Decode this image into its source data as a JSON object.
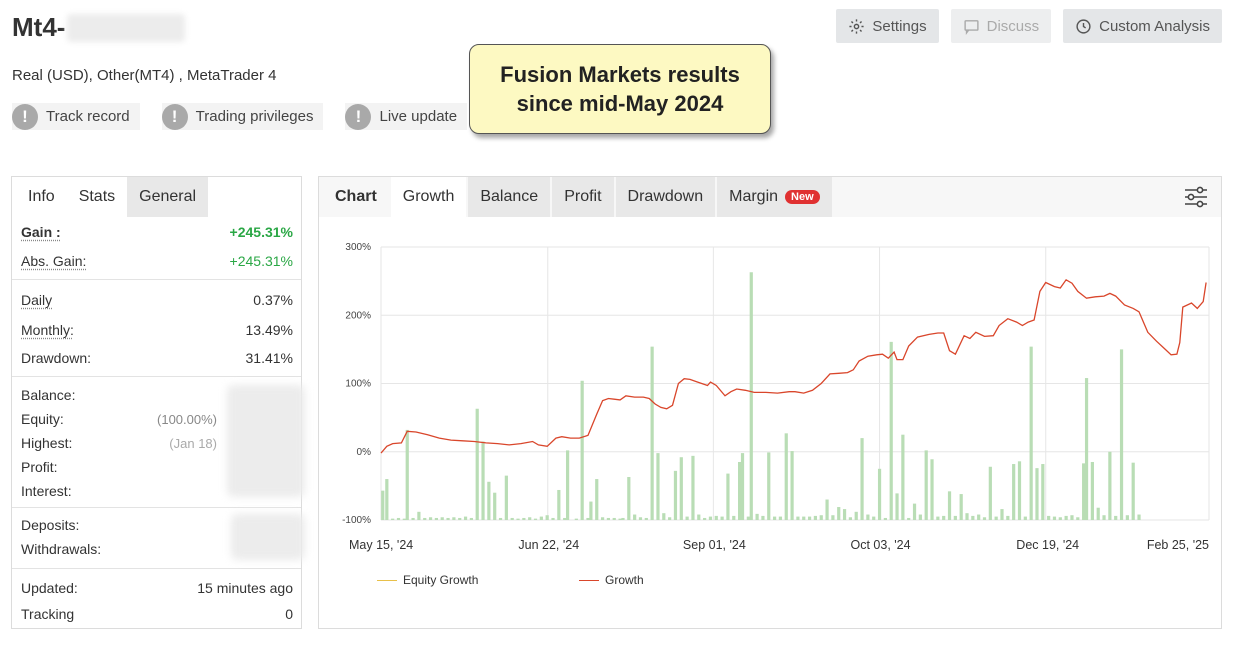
{
  "account": {
    "title_prefix": "Mt4-",
    "subtitle": "Real (USD), Other(MT4) , MetaTrader 4"
  },
  "badges": [
    {
      "label": "Track record",
      "icon": "exclamation-icon"
    },
    {
      "label": "Trading privileges",
      "icon": "exclamation-icon"
    },
    {
      "label": "Live update",
      "icon": "exclamation-icon"
    }
  ],
  "buttons": {
    "settings": "Settings",
    "discuss": "Discuss",
    "custom_analysis": "Custom Analysis"
  },
  "callout": {
    "line1": "Fusion Markets results",
    "line2": "since mid-May 2024"
  },
  "left_tabs": [
    "Info",
    "Stats",
    "General"
  ],
  "stats": {
    "gain_label": "Gain :",
    "gain_value": "+245.31%",
    "abs_gain_label": "Abs. Gain:",
    "abs_gain_value": "+245.31%",
    "daily_label": "Daily",
    "daily_value": "0.37%",
    "monthly_label": "Monthly:",
    "monthly_value": "13.49%",
    "drawdown_label": "Drawdown:",
    "drawdown_value": "31.41%",
    "balance_label": "Balance:",
    "equity_label": "Equity:",
    "equity_pct": "(100.00%)",
    "highest_label": "Highest:",
    "highest_date": "(Jan 18)",
    "profit_label": "Profit:",
    "interest_label": "Interest:",
    "deposits_label": "Deposits:",
    "withdrawals_label": "Withdrawals:",
    "updated_label": "Updated:",
    "updated_value": "15 minutes ago",
    "tracking_label": "Tracking",
    "tracking_value": "0"
  },
  "chart_tabs": {
    "head": "Chart",
    "tabs": [
      "Growth",
      "Balance",
      "Profit",
      "Drawdown",
      "Margin"
    ],
    "active": "Growth",
    "new_badge": "New"
  },
  "colors": {
    "growth_line": "#d9462b",
    "equity_line": "#e8c04a",
    "bars": "#b9ddb5",
    "gain_green": "#2aa745"
  },
  "chart_data": {
    "type": "line",
    "yticks": [
      "300%",
      "200%",
      "100%",
      "0%",
      "-100%"
    ],
    "ylim": [
      -100,
      300
    ],
    "xticks": [
      "May 15, '24",
      "Jun 22, '24",
      "Sep 01, '24",
      "Oct 03, '24",
      "Dec 19, '24",
      "Feb 25, '25"
    ],
    "legend": [
      "Equity Growth",
      "Growth"
    ],
    "growth_series": [
      [
        0,
        -2
      ],
      [
        0.01,
        8
      ],
      [
        0.02,
        12
      ],
      [
        0.035,
        13
      ],
      [
        0.045,
        30
      ],
      [
        0.06,
        29
      ],
      [
        0.08,
        25
      ],
      [
        0.1,
        20
      ],
      [
        0.12,
        17
      ],
      [
        0.14,
        16
      ],
      [
        0.16,
        15
      ],
      [
        0.18,
        13
      ],
      [
        0.2,
        12
      ],
      [
        0.22,
        10
      ],
      [
        0.24,
        12
      ],
      [
        0.26,
        15
      ],
      [
        0.27,
        10
      ],
      [
        0.285,
        8
      ],
      [
        0.3,
        20
      ],
      [
        0.31,
        22
      ],
      [
        0.325,
        20
      ],
      [
        0.34,
        20
      ],
      [
        0.355,
        24
      ],
      [
        0.37,
        55
      ],
      [
        0.38,
        75
      ],
      [
        0.39,
        78
      ],
      [
        0.4,
        77
      ],
      [
        0.41,
        76
      ],
      [
        0.42,
        82
      ],
      [
        0.435,
        80
      ],
      [
        0.45,
        80
      ],
      [
        0.46,
        78
      ],
      [
        0.47,
        70
      ],
      [
        0.48,
        65
      ],
      [
        0.49,
        63
      ],
      [
        0.5,
        68
      ],
      [
        0.51,
        100
      ],
      [
        0.52,
        107
      ],
      [
        0.53,
        106
      ],
      [
        0.54,
        103
      ],
      [
        0.55,
        100
      ],
      [
        0.56,
        97
      ],
      [
        0.565,
        102
      ],
      [
        0.575,
        97
      ],
      [
        0.59,
        82
      ],
      [
        0.6,
        88
      ],
      [
        0.61,
        92
      ],
      [
        0.625,
        90
      ],
      [
        0.64,
        87
      ],
      [
        0.66,
        87
      ],
      [
        0.68,
        86
      ],
      [
        0.7,
        88
      ],
      [
        0.71,
        88
      ],
      [
        0.725,
        86
      ],
      [
        0.74,
        90
      ],
      [
        0.755,
        100
      ],
      [
        0.77,
        114
      ],
      [
        0.785,
        115
      ],
      [
        0.8,
        116
      ],
      [
        0.81,
        120
      ],
      [
        0.82,
        133
      ],
      [
        0.835,
        140
      ],
      [
        0.85,
        142
      ],
      [
        0.86,
        143
      ],
      [
        0.87,
        137
      ],
      [
        0.88,
        146
      ],
      [
        0.885,
        135
      ],
      [
        0.895,
        135
      ],
      [
        0.905,
        155
      ],
      [
        0.92,
        168
      ],
      [
        0.94,
        172
      ],
      [
        0.955,
        174
      ],
      [
        0.965,
        174
      ],
      [
        0.975,
        148
      ],
      [
        0.985,
        143
      ],
      [
        1.0,
        170
      ],
      [
        1.01,
        166
      ],
      [
        1.02,
        175
      ],
      [
        1.035,
        169
      ],
      [
        1.05,
        170
      ],
      [
        1.06,
        185
      ],
      [
        1.075,
        195
      ],
      [
        1.09,
        190
      ],
      [
        1.1,
        185
      ],
      [
        1.11,
        190
      ],
      [
        1.12,
        193
      ],
      [
        1.13,
        235
      ],
      [
        1.14,
        248
      ],
      [
        1.155,
        242
      ],
      [
        1.165,
        240
      ],
      [
        1.175,
        252
      ],
      [
        1.185,
        247
      ],
      [
        1.195,
        235
      ],
      [
        1.21,
        225
      ],
      [
        1.225,
        227
      ],
      [
        1.24,
        228
      ],
      [
        1.25,
        232
      ],
      [
        1.26,
        228
      ],
      [
        1.275,
        215
      ],
      [
        1.29,
        210
      ],
      [
        1.3,
        205
      ],
      [
        1.315,
        175
      ],
      [
        1.33,
        162
      ],
      [
        1.345,
        150
      ],
      [
        1.355,
        142
      ],
      [
        1.365,
        143
      ],
      [
        1.37,
        160
      ],
      [
        1.375,
        212
      ],
      [
        1.39,
        218
      ],
      [
        1.4,
        210
      ],
      [
        1.41,
        220
      ],
      [
        1.415,
        248
      ]
    ],
    "bar_series": [
      [
        0.003,
        -57
      ],
      [
        0.01,
        -40
      ],
      [
        0.02,
        -98
      ],
      [
        0.03,
        -97
      ],
      [
        0.04,
        -98
      ],
      [
        0.045,
        32
      ],
      [
        0.055,
        -97
      ],
      [
        0.065,
        -88
      ],
      [
        0.075,
        -97
      ],
      [
        0.085,
        -96
      ],
      [
        0.095,
        -97
      ],
      [
        0.105,
        -96
      ],
      [
        0.115,
        -97
      ],
      [
        0.125,
        -96
      ],
      [
        0.135,
        -97
      ],
      [
        0.145,
        -95
      ],
      [
        0.155,
        -97
      ],
      [
        0.165,
        63
      ],
      [
        0.175,
        15
      ],
      [
        0.185,
        -44
      ],
      [
        0.195,
        -60
      ],
      [
        0.205,
        -97
      ],
      [
        0.215,
        -35
      ],
      [
        0.225,
        -97
      ],
      [
        0.235,
        -98
      ],
      [
        0.245,
        -97
      ],
      [
        0.255,
        -96
      ],
      [
        0.265,
        -98
      ],
      [
        0.275,
        -95
      ],
      [
        0.285,
        -93
      ],
      [
        0.295,
        -97
      ],
      [
        0.305,
        -56
      ],
      [
        0.315,
        -97
      ],
      [
        0.32,
        2
      ],
      [
        0.335,
        -98
      ],
      [
        0.345,
        104
      ],
      [
        0.355,
        -97
      ],
      [
        0.36,
        -73
      ],
      [
        0.37,
        -40
      ],
      [
        0.38,
        -96
      ],
      [
        0.39,
        -97
      ],
      [
        0.4,
        -97
      ],
      [
        0.41,
        -98
      ],
      [
        0.415,
        -97
      ],
      [
        0.425,
        -37
      ],
      [
        0.435,
        -92
      ],
      [
        0.445,
        -96
      ],
      [
        0.455,
        -97
      ],
      [
        0.465,
        154
      ],
      [
        0.475,
        -2
      ],
      [
        0.485,
        -90
      ],
      [
        0.495,
        -96
      ],
      [
        0.505,
        -28
      ],
      [
        0.515,
        -8
      ],
      [
        0.525,
        -95
      ],
      [
        0.535,
        -6
      ],
      [
        0.545,
        -92
      ],
      [
        0.555,
        -97
      ],
      [
        0.565,
        -95
      ],
      [
        0.575,
        -94
      ],
      [
        0.585,
        -95
      ],
      [
        0.595,
        -32
      ],
      [
        0.605,
        -94
      ],
      [
        0.615,
        -15
      ],
      [
        0.62,
        -2
      ],
      [
        0.63,
        -95
      ],
      [
        0.635,
        263
      ],
      [
        0.645,
        -91
      ],
      [
        0.655,
        -94
      ],
      [
        0.665,
        -1
      ],
      [
        0.675,
        -95
      ],
      [
        0.685,
        -95
      ],
      [
        0.695,
        27
      ],
      [
        0.705,
        1
      ],
      [
        0.715,
        -95
      ],
      [
        0.725,
        -95
      ],
      [
        0.735,
        -95
      ],
      [
        0.745,
        -94
      ],
      [
        0.755,
        -93
      ],
      [
        0.765,
        -70
      ],
      [
        0.775,
        -93
      ],
      [
        0.785,
        -81
      ],
      [
        0.795,
        -84
      ],
      [
        0.805,
        -96
      ],
      [
        0.815,
        -88
      ],
      [
        0.825,
        20
      ],
      [
        0.835,
        -92
      ],
      [
        0.845,
        -95
      ],
      [
        0.855,
        -25
      ],
      [
        0.865,
        -97
      ],
      [
        0.875,
        161
      ],
      [
        0.885,
        -61
      ],
      [
        0.895,
        25
      ],
      [
        0.905,
        -97
      ],
      [
        0.915,
        -76
      ],
      [
        0.925,
        -92
      ],
      [
        0.935,
        2
      ],
      [
        0.945,
        -11
      ],
      [
        0.955,
        -95
      ],
      [
        0.965,
        -94
      ],
      [
        0.975,
        -58
      ],
      [
        0.985,
        -94
      ],
      [
        0.995,
        -62
      ],
      [
        1.005,
        -90
      ],
      [
        1.015,
        -94
      ],
      [
        1.025,
        -92
      ],
      [
        1.035,
        -96
      ],
      [
        1.045,
        -22
      ],
      [
        1.055,
        -95
      ],
      [
        1.065,
        -84
      ],
      [
        1.075,
        -94
      ],
      [
        1.085,
        -18
      ],
      [
        1.095,
        -14
      ],
      [
        1.105,
        -95
      ],
      [
        1.115,
        154
      ],
      [
        1.125,
        -24
      ],
      [
        1.135,
        -18
      ],
      [
        1.145,
        -94
      ],
      [
        1.155,
        -95
      ],
      [
        1.165,
        -96
      ],
      [
        1.175,
        -94
      ],
      [
        1.185,
        -93
      ],
      [
        1.195,
        -96
      ],
      [
        1.205,
        -17
      ],
      [
        1.21,
        108
      ],
      [
        1.22,
        -15
      ],
      [
        1.23,
        -82
      ],
      [
        1.24,
        -93
      ],
      [
        1.25,
        0
      ],
      [
        1.26,
        -94
      ],
      [
        1.27,
        150
      ],
      [
        1.28,
        -93
      ],
      [
        1.29,
        -16
      ],
      [
        1.3,
        -92
      ]
    ]
  }
}
